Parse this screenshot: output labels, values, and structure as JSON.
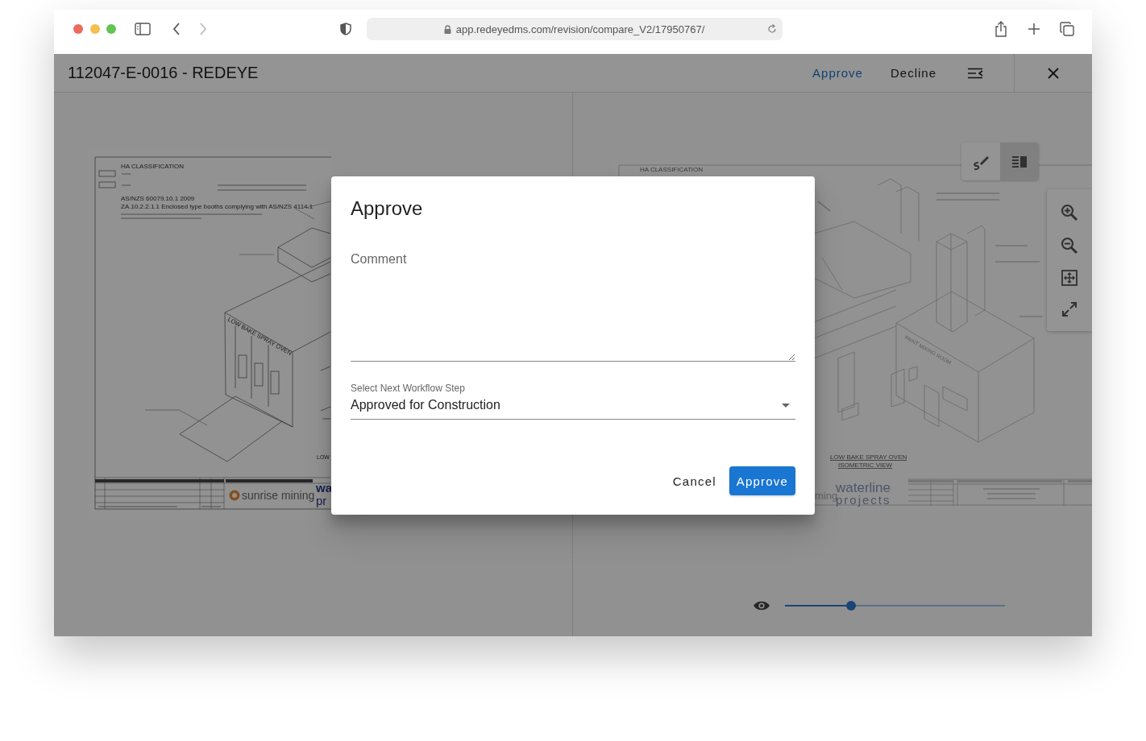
{
  "browser": {
    "url": "app.redeyedms.com/revision/compare_V2/17950767/",
    "forward_disabled": true
  },
  "header": {
    "title": "112047-E-0016 - REDEYE",
    "actions": [
      {
        "label": "Approve",
        "kind": "primary"
      },
      {
        "label": "Decline",
        "kind": "plain"
      }
    ]
  },
  "left_sheet": {
    "heading": "HA CLASSIFICATION",
    "standard": "AS/NZS 60079.10.1 2009",
    "clause": "ZA.10.2.2.1.1 Enclosed type booths complying with AS/NZS 4114.1",
    "booth_label": "LOW BAKE SPRAY OVEN",
    "view_title_cut": "LOW",
    "client_logo": "sunrise mining",
    "consultant_logo_cut": [
      "wa",
      "pr"
    ]
  },
  "right_sheet": {
    "heading": "HA CLASSIFICATION",
    "room_label": "PAINT MIXING ROOM",
    "view_title": [
      "LOW BAKE SPRAY OVEN",
      "ISOMETRIC VIEW"
    ],
    "client_logo_cut": "ming",
    "consultant_logo": [
      "waterline",
      "projects"
    ]
  },
  "view_toolbar": [
    {
      "kind": "annotate",
      "selected": false
    },
    {
      "kind": "side_by_side",
      "selected": true
    }
  ],
  "overlay_slider": {
    "level": 0.3
  },
  "dialog": {
    "title": "Approve",
    "comment_placeholder": "Comment",
    "step_label": "Select Next Workflow Step",
    "step_value": "Approved for Construction",
    "buttons": [
      {
        "label": "Cancel",
        "kind": "text"
      },
      {
        "label": "Approve",
        "kind": "contained"
      }
    ]
  }
}
